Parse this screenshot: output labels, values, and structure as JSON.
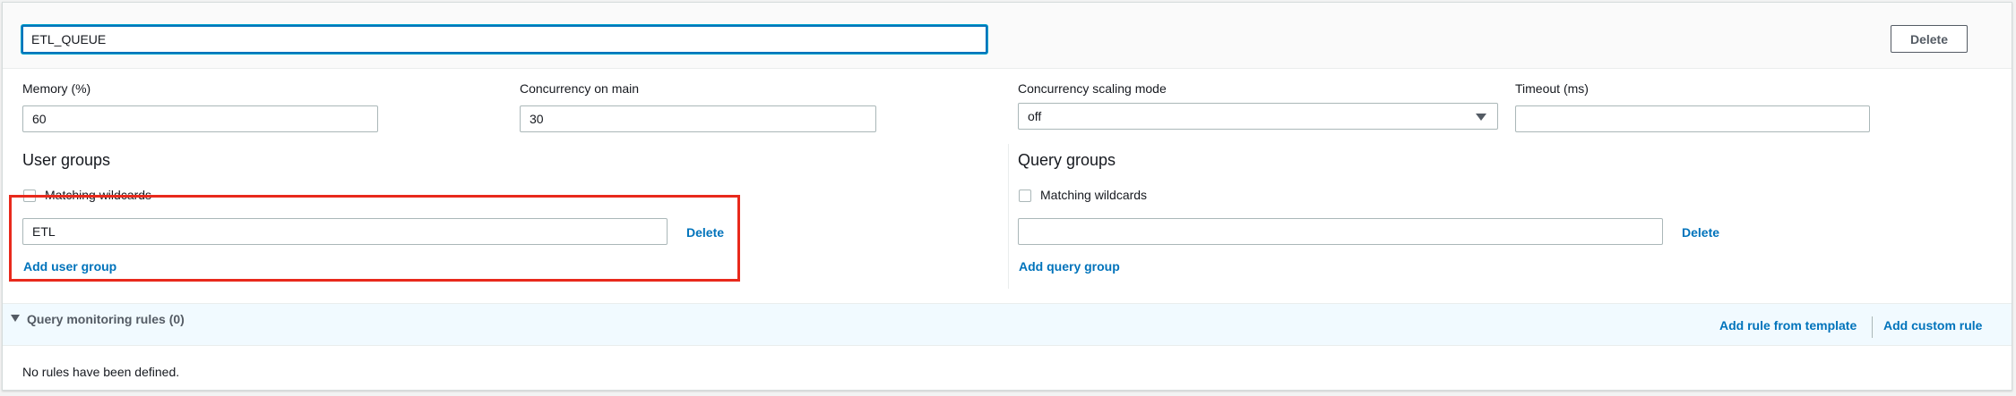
{
  "queue": {
    "name_value": "ETL_QUEUE",
    "delete_label": "Delete"
  },
  "fields": {
    "memory_label": "Memory (%)",
    "memory_value": "60",
    "concurrency_label": "Concurrency on main",
    "concurrency_value": "30",
    "scaling_label": "Concurrency scaling mode",
    "scaling_value": "off",
    "timeout_label": "Timeout (ms)",
    "timeout_value": ""
  },
  "user_groups": {
    "title": "User groups",
    "wildcards_label": "Matching wildcards",
    "group_value": "ETL",
    "delete_label": "Delete",
    "add_label": "Add user group"
  },
  "query_groups": {
    "title": "Query groups",
    "wildcards_label": "Matching wildcards",
    "group_value": "",
    "delete_label": "Delete",
    "add_label": "Add query group"
  },
  "monitoring": {
    "title": "Query monitoring rules (0)",
    "add_template_label": "Add rule from template",
    "add_custom_label": "Add custom rule",
    "empty_text": "No rules have been defined."
  },
  "colors": {
    "link": "#0073bb",
    "focus": "#0073bb",
    "highlight": "#e8291c"
  },
  "icons": {
    "caret_select": "chevron-down-icon",
    "caret_section": "triangle-down-icon"
  }
}
